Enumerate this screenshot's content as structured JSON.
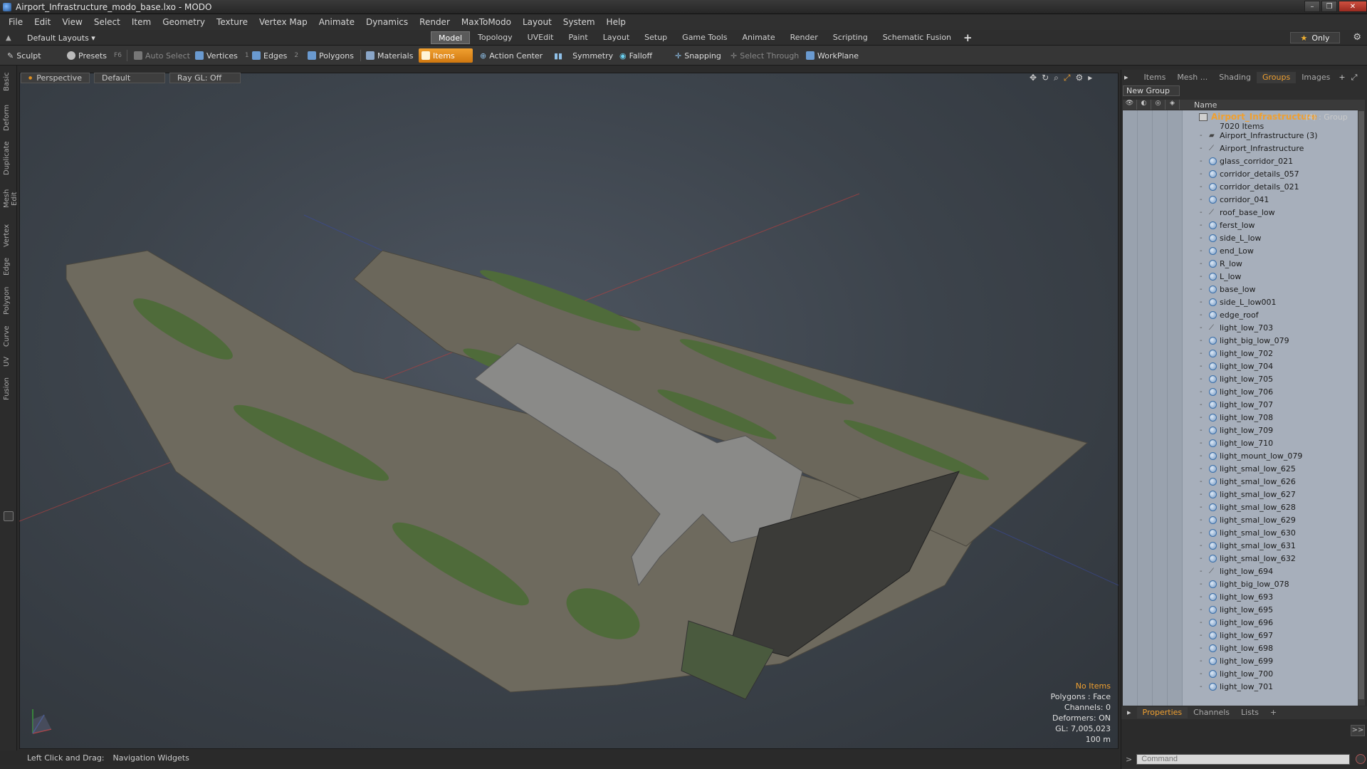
{
  "window": {
    "title": "Airport_Infrastructure_modo_base.lxo - MODO",
    "controls": [
      "–",
      "❐",
      "✕"
    ]
  },
  "menu": [
    "File",
    "Edit",
    "View",
    "Select",
    "Item",
    "Geometry",
    "Texture",
    "Vertex Map",
    "Animate",
    "Dynamics",
    "Render",
    "MaxToModo",
    "Layout",
    "System",
    "Help"
  ],
  "layoutbar": {
    "layout_label": "Default Layouts ▾",
    "modes": [
      "Model",
      "Topology",
      "UVEdit",
      "Paint",
      "Layout",
      "Setup",
      "Game Tools",
      "Animate",
      "Render",
      "Scripting",
      "Schematic Fusion"
    ],
    "active_mode": "Model",
    "plus": "+",
    "only_label": "Only"
  },
  "toolbar": {
    "sculpt": "Sculpt",
    "presets": "Presets",
    "presets_key": "F6",
    "auto_select": "Auto Select",
    "vertices": "Vertices",
    "vertices_key": "1",
    "edges": "Edges",
    "edges_key": "2",
    "polygons": "Polygons",
    "materials": "Materials",
    "items": "Items",
    "action_center": "Action Center",
    "symmetry": "Symmetry",
    "falloff": "Falloff",
    "snapping": "Snapping",
    "select_through": "Select Through",
    "workplane": "WorkPlane"
  },
  "left_tabs": [
    "Basic",
    "Deform",
    "Duplicate",
    "Mesh Edit",
    "Vertex",
    "Edge",
    "Polygon",
    "Curve",
    "UV",
    "Fusion"
  ],
  "viewport": {
    "view": "Perspective",
    "shading": "Default",
    "raygl": "Ray GL: Off",
    "hud": {
      "no_items": "No Items",
      "polygons": "Polygons : Face",
      "channels": "Channels: 0",
      "deformers": "Deformers: ON",
      "gl": "GL: 7,005,023",
      "scale": "100 m"
    }
  },
  "status": {
    "action": "Left Click and Drag:",
    "target": "Navigation Widgets"
  },
  "right_panel": {
    "tabs": [
      "Items",
      "Mesh ...",
      "Shading",
      "Groups",
      "Images"
    ],
    "active_tab": "Groups",
    "new_group": "New Group",
    "column_name": "Name",
    "group": {
      "name": "Airport_Infrastructure",
      "meta": "(4) : Group",
      "count": "7020 Items"
    },
    "items": [
      {
        "name": "Airport_Infrastructure (3)",
        "type": "group"
      },
      {
        "name": "Airport_Infrastructure",
        "type": "locator"
      },
      {
        "name": "glass_corridor_021",
        "type": "mesh"
      },
      {
        "name": "corridor_details_057",
        "type": "mesh"
      },
      {
        "name": "corridor_details_021",
        "type": "mesh"
      },
      {
        "name": "corridor_041",
        "type": "mesh"
      },
      {
        "name": "roof_base_low",
        "type": "locator"
      },
      {
        "name": "ferst_low",
        "type": "mesh"
      },
      {
        "name": "side_L_low",
        "type": "mesh"
      },
      {
        "name": "end_Low",
        "type": "mesh"
      },
      {
        "name": "R_low",
        "type": "mesh"
      },
      {
        "name": "L_low",
        "type": "mesh"
      },
      {
        "name": "base_low",
        "type": "mesh"
      },
      {
        "name": "side_L_low001",
        "type": "mesh"
      },
      {
        "name": "edge_roof",
        "type": "mesh"
      },
      {
        "name": "light_low_703",
        "type": "locator"
      },
      {
        "name": "light_big_low_079",
        "type": "mesh"
      },
      {
        "name": "light_low_702",
        "type": "mesh"
      },
      {
        "name": "light_low_704",
        "type": "mesh"
      },
      {
        "name": "light_low_705",
        "type": "mesh"
      },
      {
        "name": "light_low_706",
        "type": "mesh"
      },
      {
        "name": "light_low_707",
        "type": "mesh"
      },
      {
        "name": "light_low_708",
        "type": "mesh"
      },
      {
        "name": "light_low_709",
        "type": "mesh"
      },
      {
        "name": "light_low_710",
        "type": "mesh"
      },
      {
        "name": "light_mount_low_079",
        "type": "mesh"
      },
      {
        "name": "light_smal_low_625",
        "type": "mesh"
      },
      {
        "name": "light_smal_low_626",
        "type": "mesh"
      },
      {
        "name": "light_smal_low_627",
        "type": "mesh"
      },
      {
        "name": "light_smal_low_628",
        "type": "mesh"
      },
      {
        "name": "light_smal_low_629",
        "type": "mesh"
      },
      {
        "name": "light_smal_low_630",
        "type": "mesh"
      },
      {
        "name": "light_smal_low_631",
        "type": "mesh"
      },
      {
        "name": "light_smal_low_632",
        "type": "mesh"
      },
      {
        "name": "light_low_694",
        "type": "locator"
      },
      {
        "name": "light_big_low_078",
        "type": "mesh"
      },
      {
        "name": "light_low_693",
        "type": "mesh"
      },
      {
        "name": "light_low_695",
        "type": "mesh"
      },
      {
        "name": "light_low_696",
        "type": "mesh"
      },
      {
        "name": "light_low_697",
        "type": "mesh"
      },
      {
        "name": "light_low_698",
        "type": "mesh"
      },
      {
        "name": "light_low_699",
        "type": "mesh"
      },
      {
        "name": "light_low_700",
        "type": "mesh"
      },
      {
        "name": "light_low_701",
        "type": "mesh"
      }
    ],
    "bottom_tabs": [
      "Properties",
      "Channels",
      "Lists"
    ],
    "active_bottom_tab": "Properties",
    "expand": ">>",
    "command_prompt": ">",
    "command_placeholder": "Command"
  },
  "colors": {
    "accent": "#f0a030",
    "tree_bg": "#a7afbb",
    "viewport_bg": "#3c434b"
  }
}
